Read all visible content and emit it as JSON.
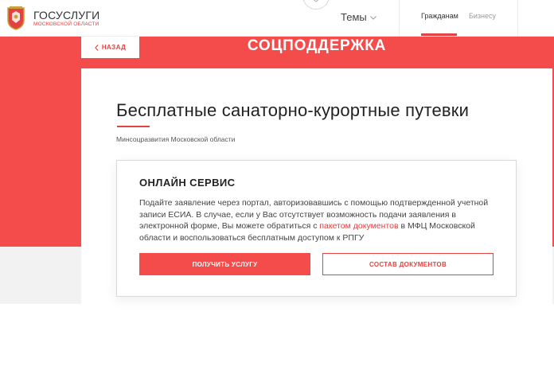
{
  "header": {
    "logo_title": "ГОСУСЛУГИ",
    "logo_subtitle": "МОСКОВСКОЙ ОБЛАСТИ",
    "emblem_icon": "coat-of-arms-icon",
    "themes_label": "Темы",
    "nav": [
      {
        "label": "Гражданам",
        "active": true
      },
      {
        "label": "Бизнесу",
        "active": false
      }
    ]
  },
  "hero": {
    "back_label": "НАЗАД",
    "section_title": "СОЦПОДДЕРЖКА"
  },
  "page": {
    "title": "Бесплатные санаторно-курортные путевки",
    "ministry": "Минсоцразвития Московской области"
  },
  "service": {
    "title": "ОНЛАЙН СЕРВИС",
    "text_part1": "Подайте заявление через портал, авторизовавшись с помощью подтвержденной учетной записи ЕСИА. В случае, если у Вас отсутствует возможность подачи заявления в электронной форме, Вы можете обратиться с ",
    "text_link": "пакетом документов",
    "text_part2": " в МФЦ Московской области и воспользоваться бесплатным доступом к РПГУ",
    "primary_button": "ПОЛУЧИТЬ УСЛУГУ",
    "secondary_button": "СОСТАВ ДОКУМЕНТОВ"
  },
  "colors": {
    "accent": "#f44c4a",
    "accent_text": "#e4423f"
  }
}
